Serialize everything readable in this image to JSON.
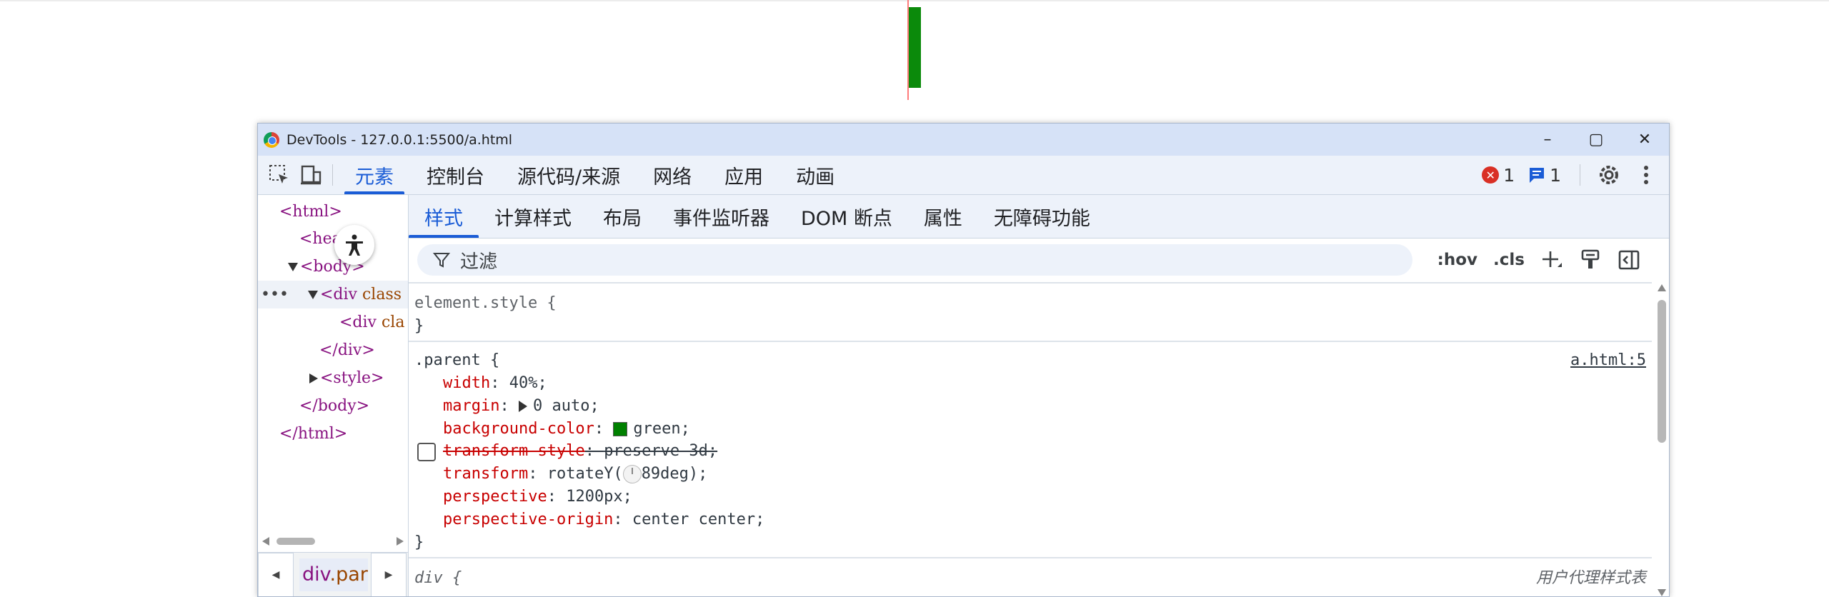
{
  "window": {
    "title": "DevTools - 127.0.0.1:5500/a.html",
    "controls": {
      "minimize": "–",
      "maximize": "▢",
      "close": "✕"
    }
  },
  "toolbar": {
    "tabs": [
      {
        "label": "元素",
        "active": true
      },
      {
        "label": "控制台"
      },
      {
        "label": "源代码/来源"
      },
      {
        "label": "网络"
      },
      {
        "label": "应用"
      },
      {
        "label": "动画"
      }
    ],
    "error_count": "1",
    "message_count": "1",
    "icons": {
      "inspect": "inspect-icon",
      "device": "device-toolbar-icon",
      "settings": "gear-icon",
      "more": "more-vert-icon"
    }
  },
  "dom_tree": {
    "lines": {
      "html_open": "<html>",
      "head": "<head>",
      "body_open": "<body>",
      "div_parent_prefix": "<div ",
      "div_parent_attr": "class",
      "div_child_prefix": "<div ",
      "div_child_attr": "cla",
      "div_close": "</div>",
      "style": "<style>",
      "body_close": "</body>",
      "html_close": "</html>"
    },
    "selected_marker": "•••"
  },
  "breadcrumb": {
    "tag": "div",
    "class": ".par"
  },
  "subtabs": [
    {
      "label": "样式",
      "active": true
    },
    {
      "label": "计算样式"
    },
    {
      "label": "布局"
    },
    {
      "label": "事件监听器"
    },
    {
      "label": "DOM 断点"
    },
    {
      "label": "属性"
    },
    {
      "label": "无障碍功能"
    }
  ],
  "filter": {
    "placeholder": "过滤",
    "hov": ":hov",
    "cls": ".cls"
  },
  "styles": {
    "element_style": {
      "selector": "element.style {",
      "close": "}"
    },
    "parent_rule": {
      "selector": ".parent {",
      "source": "a.html:5",
      "close": "}",
      "decls": [
        {
          "prop": "width",
          "value": "40%;"
        },
        {
          "prop": "margin",
          "value": "0 auto;"
        },
        {
          "prop": "background-color",
          "value": "green;"
        },
        {
          "prop": "transform-style",
          "value": "preserve-3d;",
          "disabled": true
        },
        {
          "prop": "transform",
          "value_prefix": "rotateY(",
          "value_suffix": "89deg);"
        },
        {
          "prop": "perspective",
          "value": "1200px;"
        },
        {
          "prop": "perspective-origin",
          "value": "center center;"
        }
      ]
    },
    "ua_rule": {
      "selector": "div {",
      "source": "用户代理样式表"
    }
  }
}
